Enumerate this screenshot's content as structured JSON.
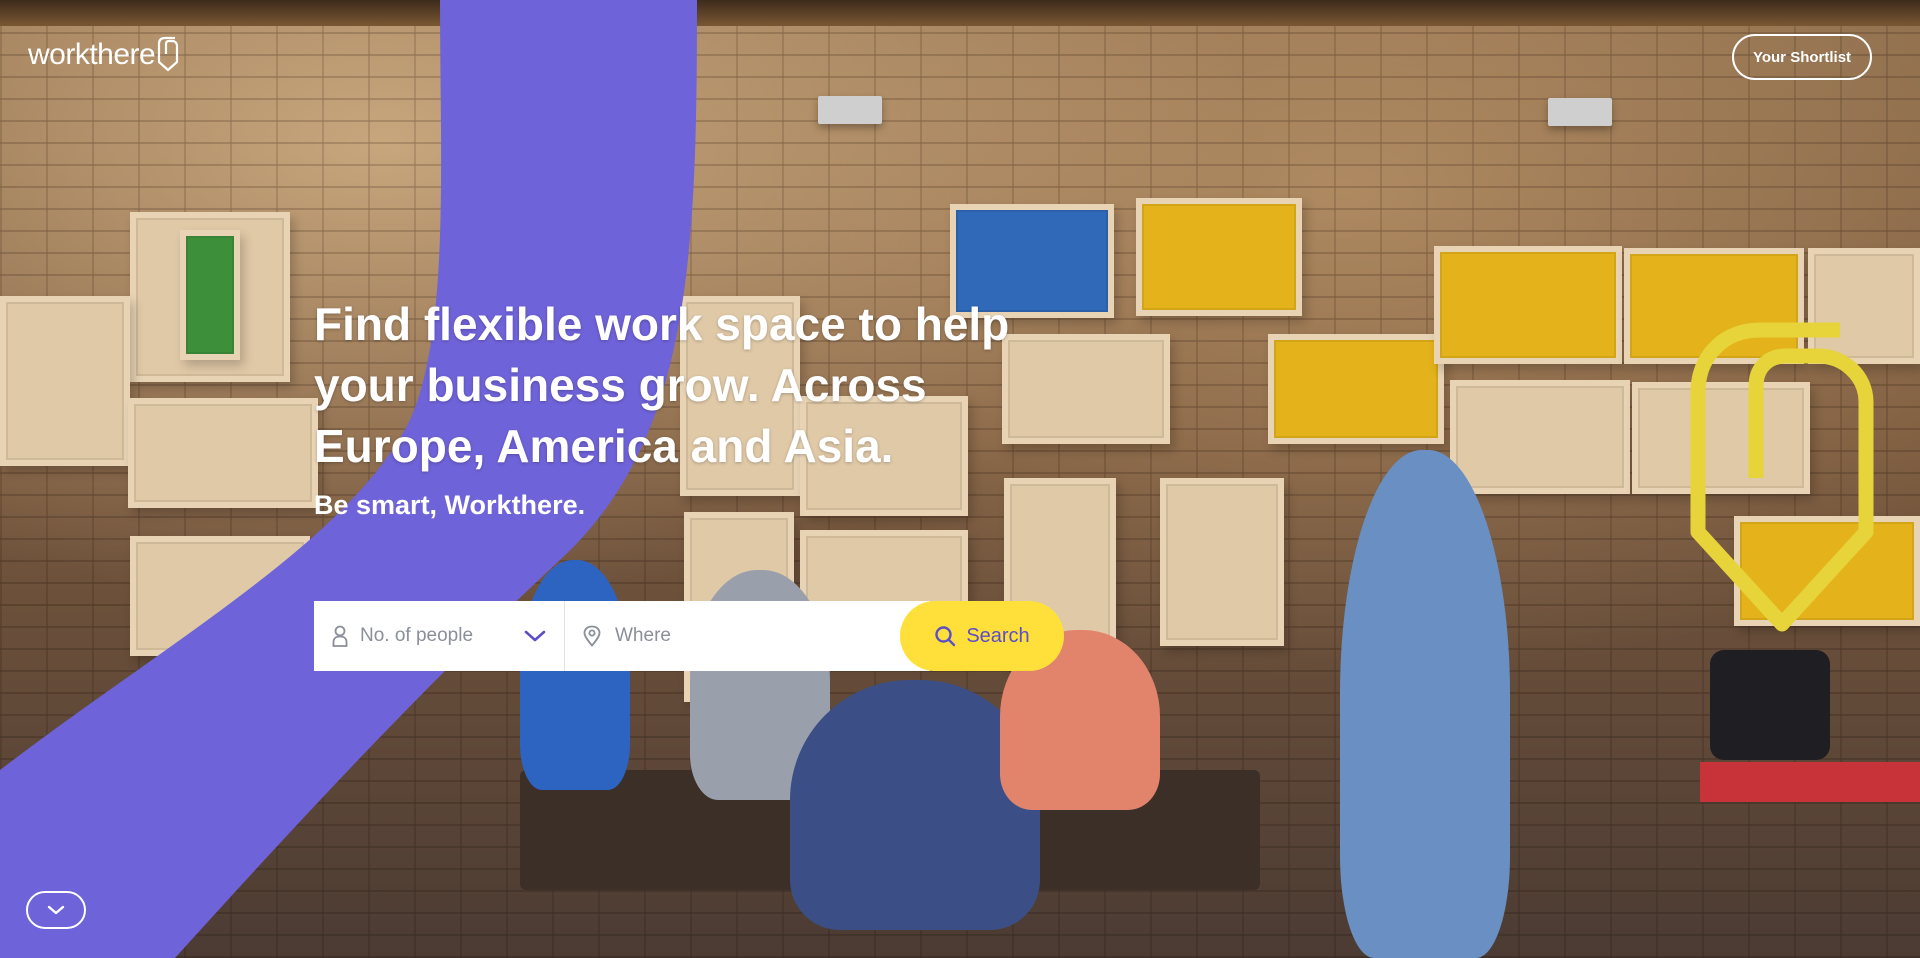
{
  "header": {
    "logo_text": "workthere",
    "shortlist_label": "Your Shortlist"
  },
  "hero": {
    "headline": "Find flexible work space to help your business grow. Across Europe, America and Asia.",
    "tagline": "Be smart, Workthere."
  },
  "search": {
    "people_placeholder": "No. of people",
    "where_placeholder": "Where",
    "button_label": "Search"
  },
  "colors": {
    "brand_purple": "#6f63d9",
    "accent_yellow": "#ffe03a",
    "search_text": "#5b4ec9"
  },
  "icons": {
    "logo_mark": "workthere-logo-icon",
    "people": "person-icon",
    "chevron": "chevron-down-icon",
    "location": "location-pin-icon",
    "search": "search-icon",
    "scroll": "chevron-down-icon"
  }
}
